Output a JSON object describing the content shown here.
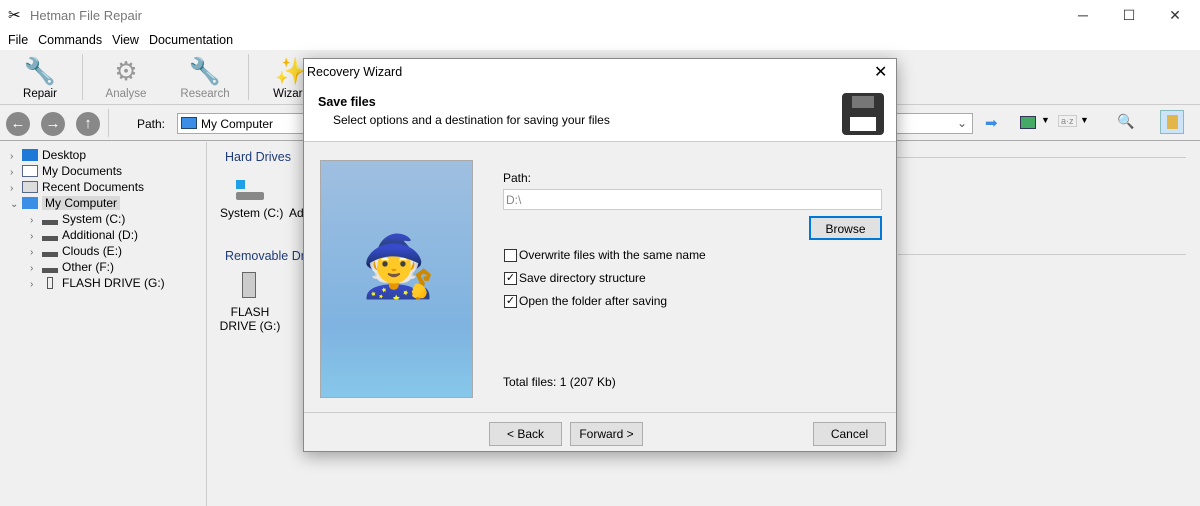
{
  "window": {
    "title": "Hetman File Repair",
    "minimize": "─",
    "maximize": "☐",
    "close": "✕"
  },
  "menu": [
    "File",
    "Commands",
    "View",
    "Documentation"
  ],
  "toolbar": [
    {
      "label": "Repair",
      "icon": "repair-icon"
    },
    {
      "label": "Analyse",
      "icon": "gear-icon"
    },
    {
      "label": "Research",
      "icon": "research-icon"
    },
    {
      "label": "Wizard",
      "icon": "wizard-icon"
    }
  ],
  "nav": {
    "path_label": "Path:",
    "path_value": "My Computer"
  },
  "tree": [
    {
      "label": "Desktop",
      "level": 0,
      "expanded": false
    },
    {
      "label": "My Documents",
      "level": 0,
      "expanded": false
    },
    {
      "label": "Recent Documents",
      "level": 0,
      "expanded": false
    },
    {
      "label": "My Computer",
      "level": 0,
      "expanded": true,
      "selected": true
    },
    {
      "label": "System (C:)",
      "level": 1
    },
    {
      "label": "Additional (D:)",
      "level": 1
    },
    {
      "label": "Clouds (E:)",
      "level": 1
    },
    {
      "label": "Other (F:)",
      "level": 1
    },
    {
      "label": "FLASH DRIVE (G:)",
      "level": 1
    }
  ],
  "content": {
    "hard_drives": "Hard Drives",
    "drive1": "System (C:)",
    "drive2_partial": "Ad",
    "removable": "Removable Dri",
    "flash": "FLASH DRIVE (G:)"
  },
  "dialog": {
    "title": "Recovery Wizard",
    "close": "✕",
    "heading": "Save files",
    "subtitle": "Select options and a destination for saving your files",
    "path_label": "Path:",
    "path_value": "D:\\",
    "browse": "Browse",
    "options": [
      {
        "label": "Overwrite files with the same name",
        "checked": false
      },
      {
        "label": "Save directory structure",
        "checked": true
      },
      {
        "label": "Open the folder after saving",
        "checked": true
      }
    ],
    "total": "Total files: 1 (207 Kb)",
    "back": "< Back",
    "forward": "Forward >",
    "cancel": "Cancel"
  }
}
